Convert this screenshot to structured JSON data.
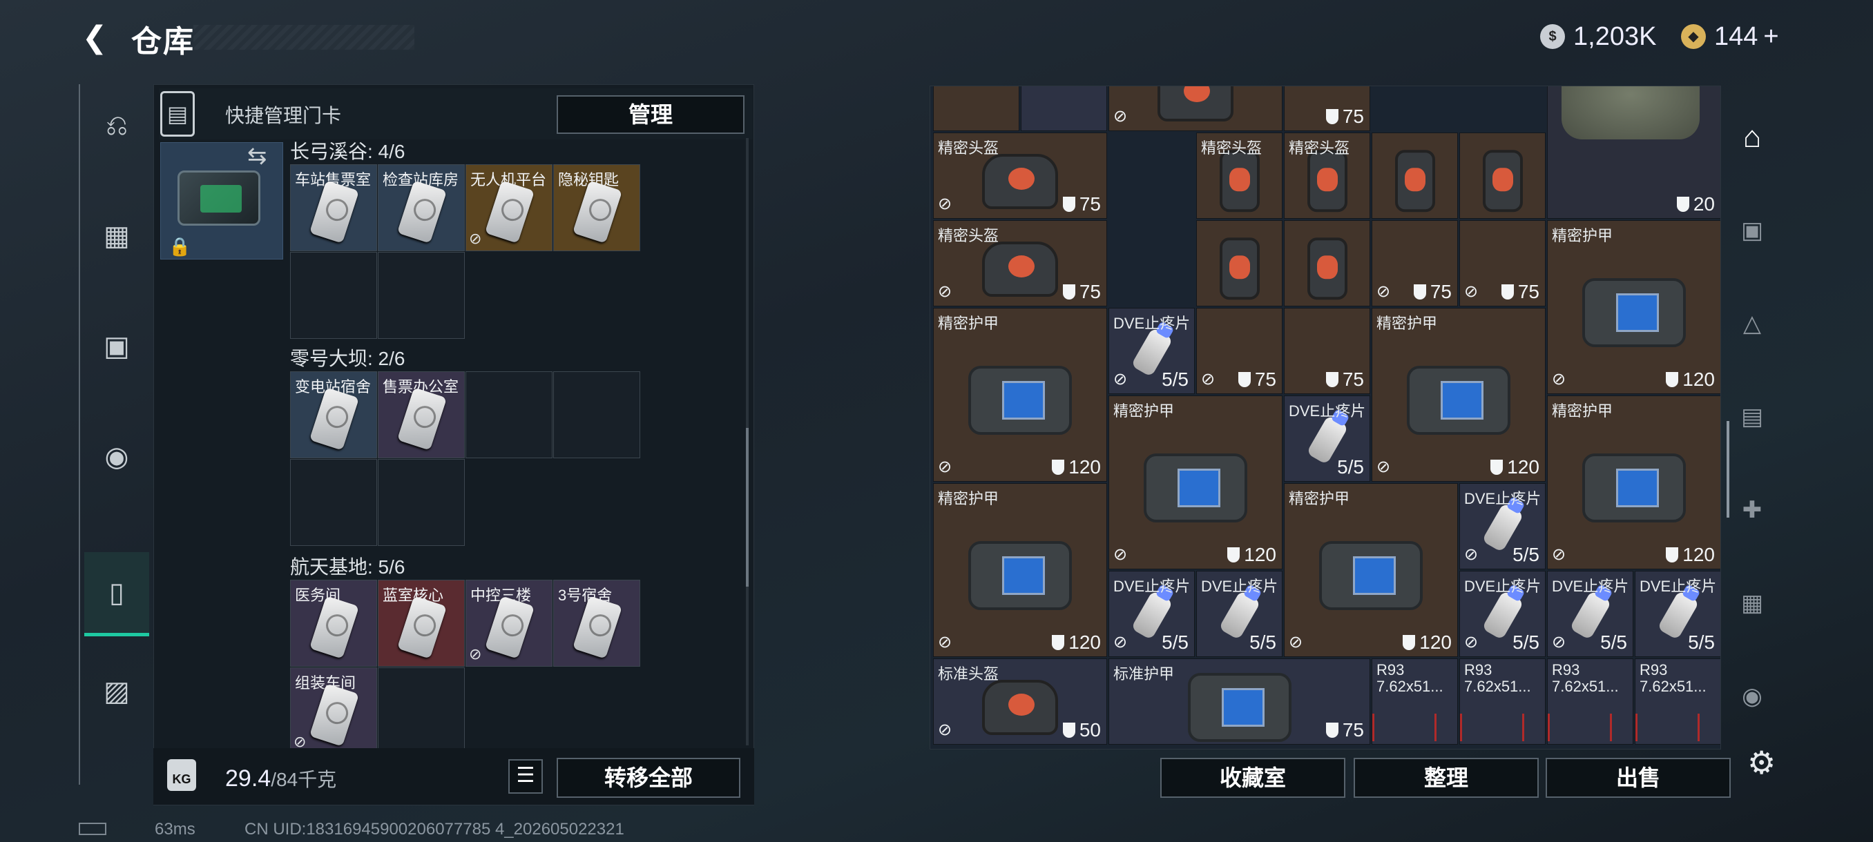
{
  "header": {
    "title": "仓库",
    "currency1": "1,203K",
    "currency2": "144",
    "currency2_plus": "+"
  },
  "left_nav": {
    "items": [
      "weapon",
      "vest",
      "backpack",
      "pouch",
      "keycard",
      "toolbox"
    ]
  },
  "quick_panel": {
    "label": "快捷管理门卡",
    "manage_button": "管理"
  },
  "groups": [
    {
      "title": "长弓溪谷: 4/6",
      "slots": [
        {
          "name": "车站售票室",
          "bg": "bg-blue",
          "uninsured": false
        },
        {
          "name": "检查站库房",
          "bg": "bg-blue",
          "uninsured": false
        },
        {
          "name": "无人机平台",
          "bg": "bg-gold",
          "uninsured": true
        },
        {
          "name": "隐秘钥匙",
          "bg": "bg-gold",
          "uninsured": false
        },
        {
          "name": "",
          "bg": "bg-empty"
        },
        {
          "name": "",
          "bg": "bg-empty"
        }
      ]
    },
    {
      "title": "零号大坝: 2/6",
      "slots": [
        {
          "name": "变电站宿舍",
          "bg": "bg-blue",
          "uninsured": false
        },
        {
          "name": "售票办公室",
          "bg": "bg-purple",
          "uninsured": false
        },
        {
          "name": "",
          "bg": "bg-empty"
        },
        {
          "name": "",
          "bg": "bg-empty"
        },
        {
          "name": "",
          "bg": "bg-empty"
        },
        {
          "name": "",
          "bg": "bg-empty"
        }
      ]
    },
    {
      "title": "航天基地: 5/6",
      "slots": [
        {
          "name": "医务间",
          "bg": "bg-purple",
          "uninsured": false
        },
        {
          "name": "蓝室核心",
          "bg": "bg-red",
          "uninsured": false
        },
        {
          "name": "中控三楼",
          "bg": "bg-purple",
          "uninsured": true
        },
        {
          "name": "3号宿舍",
          "bg": "bg-purple",
          "uninsured": false
        },
        {
          "name": "组装车间",
          "bg": "bg-purple",
          "uninsured": true
        },
        {
          "name": "",
          "bg": "bg-empty"
        }
      ]
    }
  ],
  "weight": {
    "current": "29.4",
    "max": "/84千克"
  },
  "transfer_all_button": "转移全部",
  "footer": {
    "ping": "63ms",
    "uid": "CN UID:18316945900206077785 4_202605022321"
  },
  "stash_items": [
    {
      "name": "",
      "kind": "misc",
      "bg": "b-brown",
      "c": 0,
      "r": -1,
      "w": 1,
      "h": 1,
      "val": "",
      "ni": false
    },
    {
      "name": "",
      "kind": "misc",
      "bg": "b-navy",
      "c": 1,
      "r": -1,
      "w": 1,
      "h": 1,
      "val": "",
      "ni": false
    },
    {
      "name": "",
      "kind": "helmet",
      "bg": "b-brown",
      "c": 2,
      "r": -1,
      "w": 2,
      "h": 1,
      "val": "",
      "ni": true
    },
    {
      "name": "",
      "kind": "misc",
      "bg": "b-brown",
      "c": 4,
      "r": -1,
      "w": 1,
      "h": 1,
      "val": "75",
      "ni": false
    },
    {
      "name": "精密头盔",
      "kind": "helmet",
      "bg": "b-brown",
      "c": 0,
      "r": 0,
      "w": 2,
      "h": 1,
      "val": "75",
      "ni": true
    },
    {
      "name": "精密头盔",
      "kind": "helmet-s",
      "bg": "b-brown",
      "c": 3,
      "r": 0,
      "w": 1,
      "h": 1,
      "val": "",
      "ni": false
    },
    {
      "name": "精密头盔",
      "kind": "helmet-s",
      "bg": "b-brown",
      "c": 4,
      "r": 0,
      "w": 1,
      "h": 1,
      "val": "",
      "ni": false
    },
    {
      "name": "",
      "kind": "helmet-s",
      "bg": "b-brown",
      "c": 5,
      "r": 0,
      "w": 1,
      "h": 1,
      "val": "",
      "ni": false
    },
    {
      "name": "",
      "kind": "helmet-s",
      "bg": "b-brown",
      "c": 6,
      "r": 0,
      "w": 1,
      "h": 1,
      "val": "",
      "ni": false
    },
    {
      "name": "",
      "kind": "bag",
      "bg": "b-dark",
      "c": 7,
      "r": -1,
      "w": 2,
      "h": 2,
      "val": "20",
      "ni": false
    },
    {
      "name": "精密头盔",
      "kind": "helmet",
      "bg": "b-brown",
      "c": 0,
      "r": 1,
      "w": 2,
      "h": 1,
      "val": "75",
      "ni": true
    },
    {
      "name": "",
      "kind": "helmet-s",
      "bg": "b-brown",
      "c": 3,
      "r": 1,
      "w": 1,
      "h": 1,
      "val": "",
      "ni": false
    },
    {
      "name": "",
      "kind": "helmet-s",
      "bg": "b-brown",
      "c": 4,
      "r": 1,
      "w": 1,
      "h": 1,
      "val": "",
      "ni": false
    },
    {
      "name": "",
      "kind": "none",
      "bg": "b-brown",
      "c": 5,
      "r": 1,
      "w": 1,
      "h": 1,
      "val": "75",
      "ni": true
    },
    {
      "name": "",
      "kind": "none",
      "bg": "b-brown",
      "c": 6,
      "r": 1,
      "w": 1,
      "h": 1,
      "val": "75",
      "ni": true
    },
    {
      "name": "精密护甲",
      "kind": "armor",
      "bg": "b-brown",
      "c": 7,
      "r": 1,
      "w": 2,
      "h": 2,
      "val": "120",
      "ni": true
    },
    {
      "name": "精密护甲",
      "kind": "armor",
      "bg": "b-brown",
      "c": 0,
      "r": 2,
      "w": 2,
      "h": 2,
      "val": "120",
      "ni": true
    },
    {
      "name": "DVE止疼片",
      "kind": "pill",
      "bg": "b-navy",
      "c": 2,
      "r": 2,
      "w": 1,
      "h": 1,
      "val": "5/5",
      "ni": true
    },
    {
      "name": "",
      "kind": "none",
      "bg": "b-brown",
      "c": 3,
      "r": 2,
      "w": 1,
      "h": 1,
      "val": "75",
      "ni": true
    },
    {
      "name": "",
      "kind": "none",
      "bg": "b-brown",
      "c": 4,
      "r": 2,
      "w": 1,
      "h": 1,
      "val": "75",
      "ni": false
    },
    {
      "name": "精密护甲",
      "kind": "armor",
      "bg": "b-brown",
      "c": 5,
      "r": 2,
      "w": 2,
      "h": 2,
      "val": "120",
      "ni": true
    },
    {
      "name": "精密护甲",
      "kind": "armor",
      "bg": "b-brown",
      "c": 2,
      "r": 3,
      "w": 2,
      "h": 2,
      "val": "120",
      "ni": true
    },
    {
      "name": "DVE止疼片",
      "kind": "pill",
      "bg": "b-navy",
      "c": 4,
      "r": 3,
      "w": 1,
      "h": 1,
      "val": "5/5",
      "ni": false
    },
    {
      "name": "精密护甲",
      "kind": "armor",
      "bg": "b-brown",
      "c": 7,
      "r": 3,
      "w": 2,
      "h": 2,
      "val": "120",
      "ni": true
    },
    {
      "name": "精密护甲",
      "kind": "armor",
      "bg": "b-brown",
      "c": 0,
      "r": 4,
      "w": 2,
      "h": 2,
      "val": "120",
      "ni": true
    },
    {
      "name": "精密护甲",
      "kind": "armor",
      "bg": "b-brown",
      "c": 4,
      "r": 4,
      "w": 2,
      "h": 2,
      "val": "120",
      "ni": true
    },
    {
      "name": "DVE止疼片",
      "kind": "pill",
      "bg": "b-navy",
      "c": 6,
      "r": 4,
      "w": 1,
      "h": 1,
      "val": "5/5",
      "ni": true
    },
    {
      "name": "DVE止疼片",
      "kind": "pill",
      "bg": "b-navy",
      "c": 2,
      "r": 5,
      "w": 1,
      "h": 1,
      "val": "5/5",
      "ni": true
    },
    {
      "name": "DVE止疼片",
      "kind": "pill",
      "bg": "b-navy",
      "c": 3,
      "r": 5,
      "w": 1,
      "h": 1,
      "val": "5/5",
      "ni": false
    },
    {
      "name": "DVE止疼片",
      "kind": "pill",
      "bg": "b-navy",
      "c": 6,
      "r": 5,
      "w": 1,
      "h": 1,
      "val": "5/5",
      "ni": true
    },
    {
      "name": "DVE止疼片",
      "kind": "pill",
      "bg": "b-navy",
      "c": 7,
      "r": 5,
      "w": 1,
      "h": 1,
      "val": "5/5",
      "ni": true
    },
    {
      "name": "DVE止疼片",
      "kind": "pill",
      "bg": "b-navy",
      "c": 8,
      "r": 5,
      "w": 1,
      "h": 1,
      "val": "5/5",
      "ni": false
    },
    {
      "name": "标准头盔",
      "kind": "helmet",
      "bg": "b-navy",
      "c": 0,
      "r": 6,
      "w": 2,
      "h": 1,
      "val": "50",
      "ni": true
    },
    {
      "name": "标准护甲",
      "kind": "armor",
      "bg": "b-navy",
      "c": 2,
      "r": 6,
      "w": 3,
      "h": 1,
      "val": "75",
      "ni": false
    },
    {
      "name": "R93 7.62x51...",
      "kind": "ammo",
      "bg": "b-navy",
      "c": 5,
      "r": 6,
      "w": 1,
      "h": 1,
      "val": "",
      "ni": false
    },
    {
      "name": "R93 7.62x51...",
      "kind": "ammo",
      "bg": "b-navy",
      "c": 6,
      "r": 6,
      "w": 1,
      "h": 1,
      "val": "",
      "ni": false
    },
    {
      "name": "R93 7.62x51...",
      "kind": "ammo",
      "bg": "b-navy",
      "c": 7,
      "r": 6,
      "w": 1,
      "h": 1,
      "val": "",
      "ni": false
    },
    {
      "name": "R93 7.62x51...",
      "kind": "ammo",
      "bg": "b-navy",
      "c": 8,
      "r": 6,
      "w": 1,
      "h": 1,
      "val": "",
      "ni": false
    }
  ],
  "actions": {
    "collection": "收藏室",
    "sort": "整理",
    "sell": "出售"
  }
}
